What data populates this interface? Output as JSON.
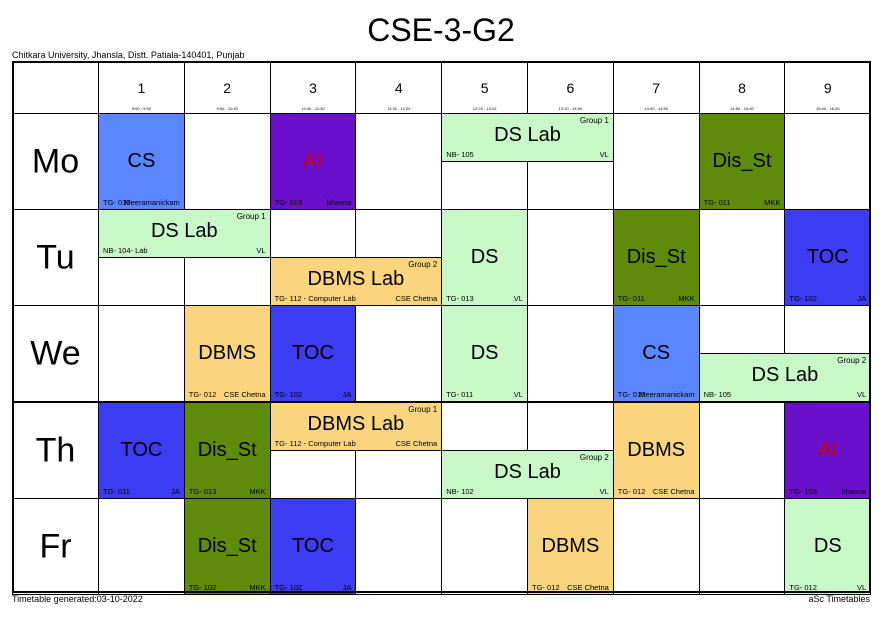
{
  "title": "CSE-3-G2",
  "institute": "Chitkara University, Jhansla, Distt. Patiala-140401, Punjab",
  "footer_left": "Timetable generated:03-10-2022",
  "footer_right": "aSc Timetables",
  "colors": {
    "CS": "#5a87ff",
    "AI": "#6a0fcc",
    "DS": "#c8f7c8",
    "Dis_St": "#5e8c0a",
    "TOC": "#3c3cf2",
    "DBMS": "#fbd57e"
  },
  "periods": [
    {
      "num": "1",
      "time": "9:00 - 9:50"
    },
    {
      "num": "2",
      "time": "9:50 - 10:40"
    },
    {
      "num": "3",
      "time": "10:40 - 11:30"
    },
    {
      "num": "4",
      "time": "11:30 - 12:20"
    },
    {
      "num": "5",
      "time": "12:20 - 13:10"
    },
    {
      "num": "6",
      "time": "13:10 - 14:00"
    },
    {
      "num": "7",
      "time": "14:00 - 14:50"
    },
    {
      "num": "8",
      "time": "14:50 - 15:40"
    },
    {
      "num": "9",
      "time": "15:40 - 16:30"
    }
  ],
  "days": [
    "Mo",
    "Tu",
    "We",
    "Th",
    "Fr"
  ],
  "lessons": [
    {
      "day": 0,
      "start": 0,
      "span": 1,
      "part": "full",
      "subject": "CS",
      "room": "TG- 010",
      "teacher": "Meeramanickam",
      "group": ""
    },
    {
      "day": 0,
      "start": 2,
      "span": 1,
      "part": "full",
      "subject": "AI",
      "room": "TG- 013",
      "teacher": "bhavna",
      "group": ""
    },
    {
      "day": 0,
      "start": 4,
      "span": 2,
      "part": "top",
      "subject": "DS Lab",
      "room": "NB- 105",
      "teacher": "VL",
      "group": "Group 1"
    },
    {
      "day": 0,
      "start": 7,
      "span": 1,
      "part": "full",
      "subject": "Dis_St",
      "room": "TG- 011",
      "teacher": "MKK",
      "group": ""
    },
    {
      "day": 1,
      "start": 0,
      "span": 2,
      "part": "top",
      "subject": "DS Lab",
      "room": "NB- 104- Lab",
      "teacher": "VL",
      "group": "Group 1"
    },
    {
      "day": 1,
      "start": 2,
      "span": 2,
      "part": "bottom",
      "subject": "DBMS Lab",
      "room": "TG- 112 - Computer Lab",
      "teacher": "CSE Chetna",
      "group": "Group 2"
    },
    {
      "day": 1,
      "start": 4,
      "span": 1,
      "part": "full",
      "subject": "DS",
      "room": "TG- 013",
      "teacher": "VL",
      "group": ""
    },
    {
      "day": 1,
      "start": 6,
      "span": 1,
      "part": "full",
      "subject": "Dis_St",
      "room": "TG- 011",
      "teacher": "MKK",
      "group": ""
    },
    {
      "day": 1,
      "start": 8,
      "span": 1,
      "part": "full",
      "subject": "TOC",
      "room": "TG- 102",
      "teacher": "JA",
      "group": ""
    },
    {
      "day": 2,
      "start": 1,
      "span": 1,
      "part": "full",
      "subject": "DBMS",
      "room": "TG- 012",
      "teacher": "CSE Chetna",
      "group": ""
    },
    {
      "day": 2,
      "start": 2,
      "span": 1,
      "part": "full",
      "subject": "TOC",
      "room": "TG- 102",
      "teacher": "JA",
      "group": ""
    },
    {
      "day": 2,
      "start": 4,
      "span": 1,
      "part": "full",
      "subject": "DS",
      "room": "TG- 011",
      "teacher": "VL",
      "group": ""
    },
    {
      "day": 2,
      "start": 6,
      "span": 1,
      "part": "full",
      "subject": "CS",
      "room": "TG- 010",
      "teacher": "Meeramanickam",
      "group": ""
    },
    {
      "day": 2,
      "start": 7,
      "span": 2,
      "part": "bottom",
      "subject": "DS Lab",
      "room": "NB- 105",
      "teacher": "VL",
      "group": "Group 2"
    },
    {
      "day": 3,
      "start": 0,
      "span": 1,
      "part": "full",
      "subject": "TOC",
      "room": "TG- 011",
      "teacher": "JA",
      "group": ""
    },
    {
      "day": 3,
      "start": 1,
      "span": 1,
      "part": "full",
      "subject": "Dis_St",
      "room": "TG- 013",
      "teacher": "MKK",
      "group": ""
    },
    {
      "day": 3,
      "start": 2,
      "span": 2,
      "part": "top",
      "subject": "DBMS Lab",
      "room": "TG- 112 - Computer Lab",
      "teacher": "CSE Chetna",
      "group": "Group 1"
    },
    {
      "day": 3,
      "start": 4,
      "span": 2,
      "part": "bottom",
      "subject": "DS Lab",
      "room": "NB- 102",
      "teacher": "VL",
      "group": "Group 2"
    },
    {
      "day": 3,
      "start": 6,
      "span": 1,
      "part": "full",
      "subject": "DBMS",
      "room": "TG- 012",
      "teacher": "CSE Chetna",
      "group": ""
    },
    {
      "day": 3,
      "start": 8,
      "span": 1,
      "part": "full",
      "subject": "AI",
      "room": "TG- 103",
      "teacher": "bhavna",
      "group": ""
    },
    {
      "day": 4,
      "start": 1,
      "span": 1,
      "part": "full",
      "subject": "Dis_St",
      "room": "TG- 102",
      "teacher": "MKK",
      "group": ""
    },
    {
      "day": 4,
      "start": 2,
      "span": 1,
      "part": "full",
      "subject": "TOC",
      "room": "TG- 102",
      "teacher": "JA",
      "group": ""
    },
    {
      "day": 4,
      "start": 5,
      "span": 1,
      "part": "full",
      "subject": "DBMS",
      "room": "TG- 012",
      "teacher": "CSE Chetna",
      "group": ""
    },
    {
      "day": 4,
      "start": 8,
      "span": 1,
      "part": "full",
      "subject": "DS",
      "room": "TG- 012",
      "teacher": "VL",
      "group": ""
    }
  ]
}
